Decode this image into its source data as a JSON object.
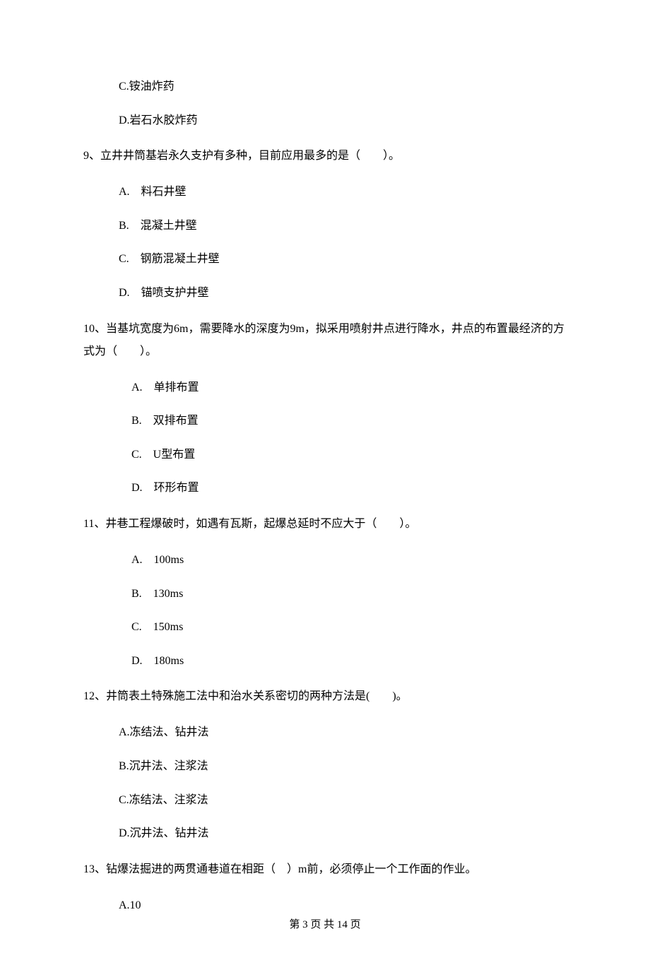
{
  "leading_options": {
    "c": "C.铵油炸药",
    "d": "D.岩石水胶炸药"
  },
  "q9": {
    "stem": "9、立井井筒基岩永久支护有多种，目前应用最多的是（　　）。",
    "a": "A.　料石井壁",
    "b": "B.　混凝土井壁",
    "c": "C.　钢筋混凝土井壁",
    "d": "D.　锚喷支护井壁"
  },
  "q10": {
    "stem": "10、当基坑宽度为6m，需要降水的深度为9m，拟采用喷射井点进行降水，井点的布置最经济的方式为（　　）。",
    "a": "A.　单排布置",
    "b": "B.　双排布置",
    "c": "C.　U型布置",
    "d": "D.　环形布置"
  },
  "q11": {
    "stem": "11、井巷工程爆破时，如遇有瓦斯，起爆总延时不应大于（　　）。",
    "a": "A.　100ms",
    "b": "B.　130ms",
    "c": "C.　150ms",
    "d": "D.　180ms"
  },
  "q12": {
    "stem": "12、井筒表土特殊施工法中和治水关系密切的两种方法是(　　)。",
    "a": "A.冻结法、钻井法",
    "b": "B.沉井法、注浆法",
    "c": "C.冻结法、注浆法",
    "d": "D.沉井法、钻井法"
  },
  "q13": {
    "stem": "13、钻爆法掘进的两贯通巷道在相距（　）m前，必须停止一个工作面的作业。",
    "a": "A.10"
  },
  "footer": "第 3 页 共 14 页"
}
